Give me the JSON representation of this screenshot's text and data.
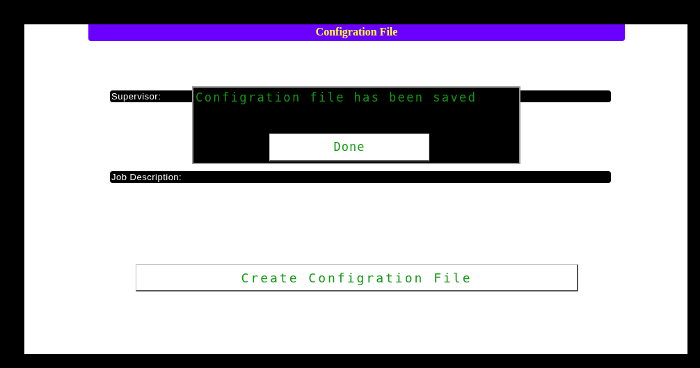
{
  "title": "Configration File",
  "fields": [
    {
      "label": "Supervisor:"
    },
    {
      "label": "Job Description:"
    }
  ],
  "create_button": "Create Configration File",
  "dialog": {
    "message": "Configration file has been saved",
    "button": "Done"
  }
}
